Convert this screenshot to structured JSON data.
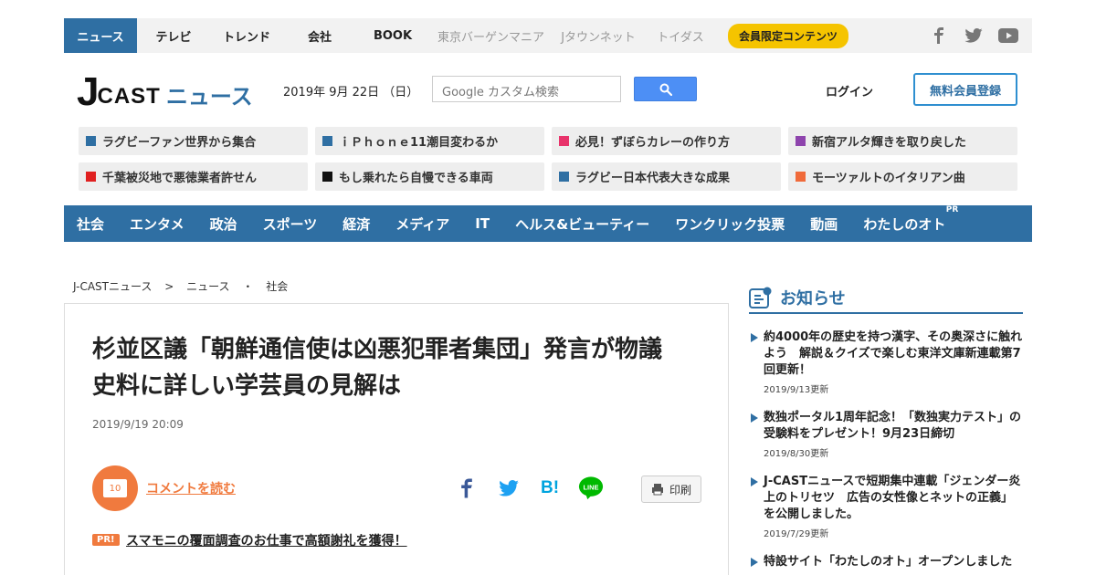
{
  "topnav": {
    "items": [
      {
        "label": "ニュース"
      },
      {
        "label": "テレビ"
      },
      {
        "label": "トレンド"
      },
      {
        "label": "会社"
      },
      {
        "label": "BOOK"
      },
      {
        "label": "東京バーゲンマニア"
      },
      {
        "label": "Jタウンネット"
      },
      {
        "label": "トイダス"
      }
    ],
    "badge": "会員限定コンテンツ",
    "social_icons": [
      "facebook-icon",
      "twitter-icon",
      "youtube-icon"
    ]
  },
  "header": {
    "logo_j": "J",
    "logo_cast": "CAST",
    "logo_news": "ニュース",
    "date": "2019年 9月 22日 （日）",
    "search_placeholder": "Google カスタム検索",
    "login": "ログイン",
    "register": "無料会員登録"
  },
  "trending": [
    {
      "label": "ラグビーファン世界から集合",
      "color": "#2f6fa3"
    },
    {
      "label": "ｉＰｈｏｎｅ11潮目変わるか",
      "color": "#2f6fa3"
    },
    {
      "label": "必見！ずぼらカレーの作り方",
      "color": "#e8336b"
    },
    {
      "label": "新宿アルタ輝きを取り戻した",
      "color": "#8e44ad"
    },
    {
      "label": "千葉被災地で悪徳業者許せん",
      "color": "#e02020"
    },
    {
      "label": "もし乗れたら自慢できる車両",
      "color": "#111111"
    },
    {
      "label": "ラグビー日本代表大きな成果",
      "color": "#2f6fa3"
    },
    {
      "label": "モーツァルトのイタリアン曲",
      "color": "#f06a3a"
    }
  ],
  "categories": [
    {
      "label": "社会"
    },
    {
      "label": "エンタメ"
    },
    {
      "label": "政治"
    },
    {
      "label": "スポーツ"
    },
    {
      "label": "経済"
    },
    {
      "label": "メディア"
    },
    {
      "label": "IT"
    },
    {
      "label": "ヘルス&ビューティー"
    },
    {
      "label": "ワンクリック投票"
    },
    {
      "label": "動画"
    },
    {
      "label": "わたしのオト",
      "tag": "PR"
    }
  ],
  "breadcrumb": [
    "J-CASTニュース",
    ">",
    "ニュース",
    "・",
    "社会"
  ],
  "article": {
    "title": "杉並区議「朝鮮通信使は凶悪犯罪者集団」発言が物議　史料に詳しい学芸員の見解は",
    "date": "2019/9/19 20:09",
    "comment_count": "10",
    "comment_link": "コメントを読む",
    "print_label": "印刷",
    "share_icons": [
      "facebook-share-icon",
      "twitter-share-icon",
      "hatena-bookmark-icon",
      "line-share-icon"
    ],
    "hatena_text": "B!",
    "line_text": "LINE",
    "pr_badge": "PR!",
    "pr_link": "スマモニの覆面調査のお仕事で高額謝礼を獲得！"
  },
  "sidebar": {
    "title": "お知らせ",
    "items": [
      {
        "text": "約4000年の歴史を持つ漢字、その奥深さに触れよう　解説＆クイズで楽しむ東洋文庫新連載第7回更新！",
        "date": "2019/9/13更新"
      },
      {
        "text": "数独ポータル1周年記念！「数独実力テスト」の受験料をプレゼント！9月23日締切",
        "date": "2019/8/30更新"
      },
      {
        "text": "J-CASTニュースで短期集中連載「ジェンダー炎上のトリセツ　広告の女性像とネットの正義」を公開しました。",
        "date": "2019/7/29更新"
      },
      {
        "text": "特設サイト「わたしのオト」オープンしました",
        "date": ""
      }
    ]
  },
  "colors": {
    "brand_blue": "#2f6fa3",
    "accent_orange": "#f07a3e",
    "badge_yellow": "#f5c400"
  }
}
